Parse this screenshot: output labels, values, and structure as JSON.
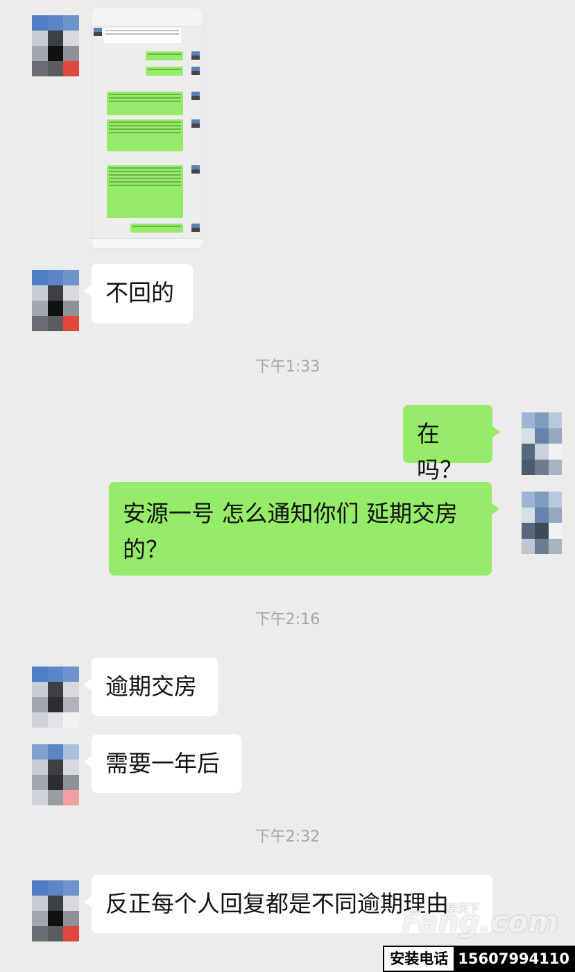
{
  "messages": {
    "not_reply": "不回的",
    "time1": "下午1:33",
    "zai_ma": "在吗？",
    "ask_delay": "安源一号 怎么通知你们 延期交房的？",
    "time2": "下午2:16",
    "overdue": "逾期交房",
    "one_year": "需要一年后",
    "time3": "下午2:32",
    "reasons": "反正每个人回复都是不同逾期理由"
  },
  "watermark": {
    "logo": "Fang.com",
    "small": "房天下"
  },
  "contact": {
    "label": "安装电话",
    "phone": "15607994110"
  },
  "colors": {
    "bg": "#ececec",
    "sent": "#95ec69",
    "received": "#ffffff",
    "time": "#a5a5a5"
  }
}
